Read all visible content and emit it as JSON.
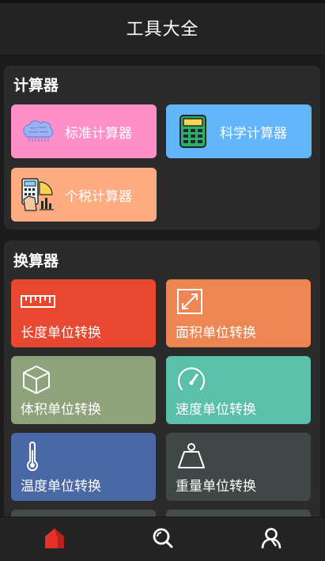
{
  "app": {
    "title": "工具大全"
  },
  "calculators": {
    "title": "计算器",
    "items": [
      {
        "label": "标准计算器",
        "color": "#ff8fc8",
        "icon": "brain-icon"
      },
      {
        "label": "科学计算器",
        "color": "#62b4fb",
        "icon": "calculator-icon"
      },
      {
        "label": "个税计算器",
        "color": "#ffab82",
        "icon": "tax-calculator-icon"
      }
    ]
  },
  "converters": {
    "title": "换算器",
    "items": [
      {
        "label": "长度单位转换",
        "color": "#e84730",
        "icon": "ruler-icon"
      },
      {
        "label": "面积单位转换",
        "color": "#ee8653",
        "icon": "resize-icon"
      },
      {
        "label": "体积单位转换",
        "color": "#8ea37c",
        "icon": "cube-icon"
      },
      {
        "label": "速度单位转换",
        "color": "#5ac0a9",
        "icon": "speedometer-icon"
      },
      {
        "label": "温度单位转换",
        "color": "#4a67a6",
        "icon": "thermometer-icon"
      },
      {
        "label": "重量单位转换",
        "color": "#3f4747",
        "icon": "weight-icon"
      }
    ]
  },
  "nav": {
    "items": [
      {
        "name": "home",
        "icon": "home-icon",
        "active": true,
        "color": "#e53228"
      },
      {
        "name": "search",
        "icon": "search-icon",
        "active": false,
        "color": "#ffffff"
      },
      {
        "name": "profile",
        "icon": "user-icon",
        "active": false,
        "color": "#ffffff"
      }
    ]
  }
}
